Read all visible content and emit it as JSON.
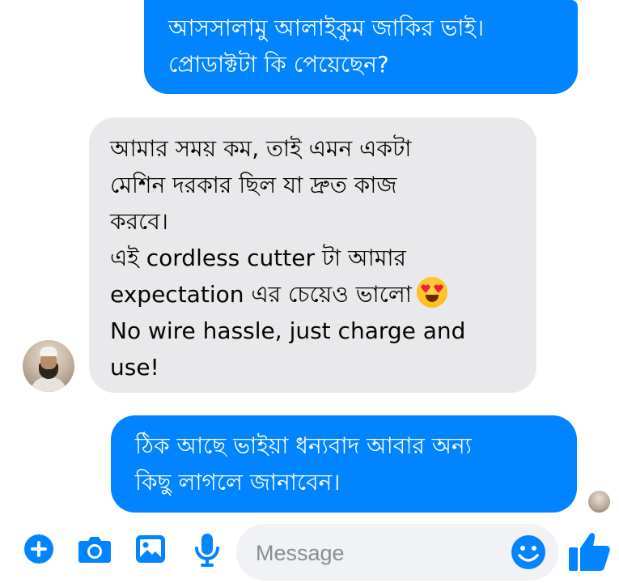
{
  "messages": {
    "outgoing_1": {
      "lines": [
        "আসসালামু আলাইকুম জাকির ভাই।",
        "প্রোডাক্টটা কি পেয়েছেন?"
      ]
    },
    "incoming_1": {
      "lines": [
        "আমার সময় কম, তাই এমন একটা",
        "মেশিন দরকার ছিল যা দ্রুত কাজ",
        "করবে।",
        "এই cordless cutter টা আমার",
        "expectation এর চেয়েও ভালো",
        "No wire hassle, just charge and",
        "use!"
      ],
      "emoji": "smiling-face-with-heart-eyes"
    },
    "outgoing_2": {
      "lines": [
        "ঠিক আছে ভাইয়া ধন্যবাদ আবার অন্য",
        "কিছু লাগলে জানাবেন।"
      ]
    }
  },
  "composer": {
    "placeholder": "Message",
    "icons": [
      "plus-icon",
      "camera-icon",
      "gallery-icon",
      "microphone-icon",
      "emoji-icon",
      "like-icon"
    ]
  },
  "colors": {
    "accent": "#0084ff",
    "incoming_bubble": "#e9e9eb",
    "composer_bg": "#f0f2f5"
  }
}
